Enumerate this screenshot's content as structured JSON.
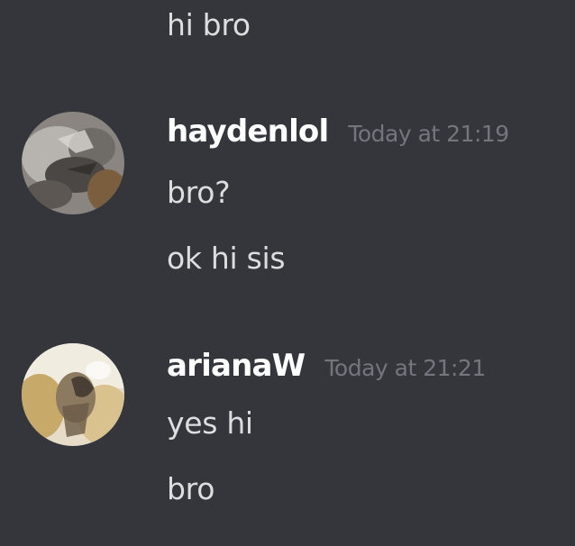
{
  "colors": {
    "background": "#35363c",
    "message_text": "#dcddde",
    "username": "#ffffff",
    "timestamp": "#72767d"
  },
  "messages": [
    {
      "continuation": true,
      "lines": [
        "hi bro"
      ]
    },
    {
      "username": "haydenlol",
      "timestamp": "Today at 21:19",
      "avatar": "user-avatar",
      "lines": [
        "bro?",
        "ok hi sis"
      ]
    },
    {
      "username": "arianaW",
      "timestamp": "Today at 21:21",
      "avatar": "user-avatar",
      "lines": [
        "yes hi",
        "bro"
      ]
    }
  ]
}
